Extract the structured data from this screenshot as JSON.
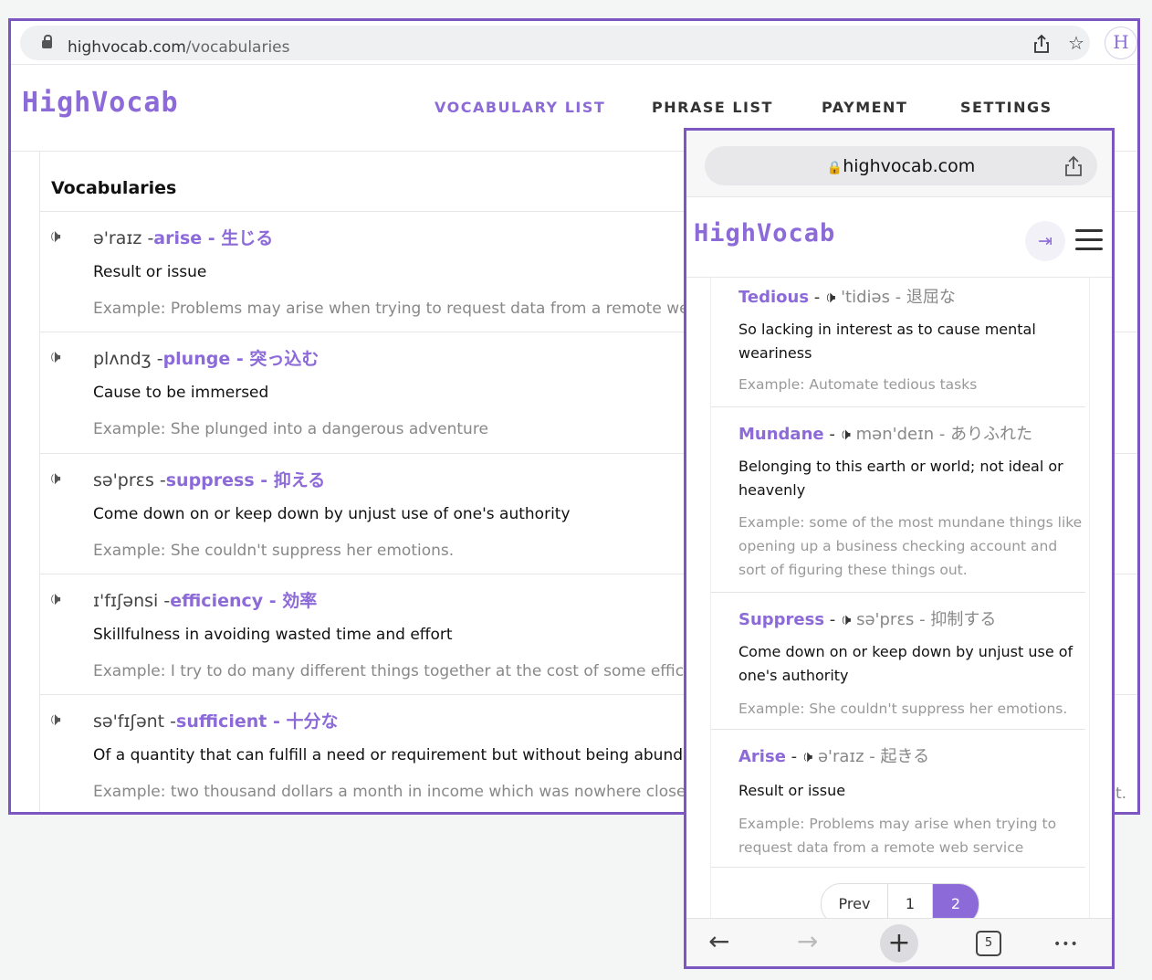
{
  "desktop": {
    "url": {
      "domain": "highvocab.com",
      "path": "/vocabularies"
    },
    "brand": "HighVocab",
    "avatar_letter": "H",
    "nav": [
      "VOCABULARY LIST",
      "PHRASE LIST",
      "PAYMENT",
      "SETTINGS"
    ],
    "heading": "Vocabularies",
    "rows": [
      {
        "phonetic": "ə'raɪz -",
        "word": "arise - 生じる",
        "definition": "Result or issue",
        "example": "Example: Problems may arise when trying to request data from a remote web s"
      },
      {
        "phonetic": "plʌndʒ -",
        "word": "plunge - 突っ込む",
        "definition": "Cause to be immersed",
        "example": "Example: She plunged into a dangerous adventure"
      },
      {
        "phonetic": "sə'prɛs -",
        "word": "suppress - 抑える",
        "definition": "Come down on or keep down by unjust use of one's authority",
        "example": "Example: She couldn't suppress her emotions."
      },
      {
        "phonetic": "ɪ'fɪʃənsi -",
        "word": "efficiency - 効率",
        "definition": "Skillfulness in avoiding wasted time and effort",
        "example": "Example: I try to do many different things together at the cost of some efficienc"
      },
      {
        "phonetic": "sə'fɪʃənt -",
        "word": "sufficient - 十分な",
        "definition": "Of a quantity that can fulfill a need or requirement but without being abundant",
        "example": "Example: two thousand dollars a month in income which was nowhere close to"
      }
    ],
    "edge_text": "t."
  },
  "mobile": {
    "url": "highvocab.com",
    "brand": "HighVocab",
    "cards": [
      {
        "word": "Tedious",
        "phonetic": "'tidiəs - 退屈な",
        "definition": "So lacking in interest as to cause mental weariness",
        "example": "Example: Automate tedious tasks"
      },
      {
        "word": "Mundane",
        "phonetic": "mən'deɪn - ありふれた",
        "definition": "Belonging to this earth or world; not ideal or heavenly",
        "example": "Example: some of the most mundane things like opening up a business checking account and sort of figuring these things out."
      },
      {
        "word": "Suppress",
        "phonetic": "sə'prɛs - 抑制する",
        "definition": "Come down on or keep down by unjust use of one's authority",
        "example": "Example: She couldn't suppress her emotions."
      },
      {
        "word": "Arise",
        "phonetic": "ə'raɪz - 起きる",
        "definition": "Result or issue",
        "example": "Example: Problems may arise when trying to request data from a remote web service"
      }
    ],
    "pager": {
      "prev": "Prev",
      "pages": [
        "1",
        "2"
      ],
      "current": "2"
    },
    "tab_count": "5"
  },
  "icons": {
    "speaker": "🕩",
    "share": "⇪",
    "star": "☆",
    "logout": "⇥",
    "back": "←",
    "forward": "→",
    "plus": "+",
    "more": "•••"
  },
  "colors": {
    "accent": "#8c6ad8",
    "frame": "#7d57c1"
  }
}
